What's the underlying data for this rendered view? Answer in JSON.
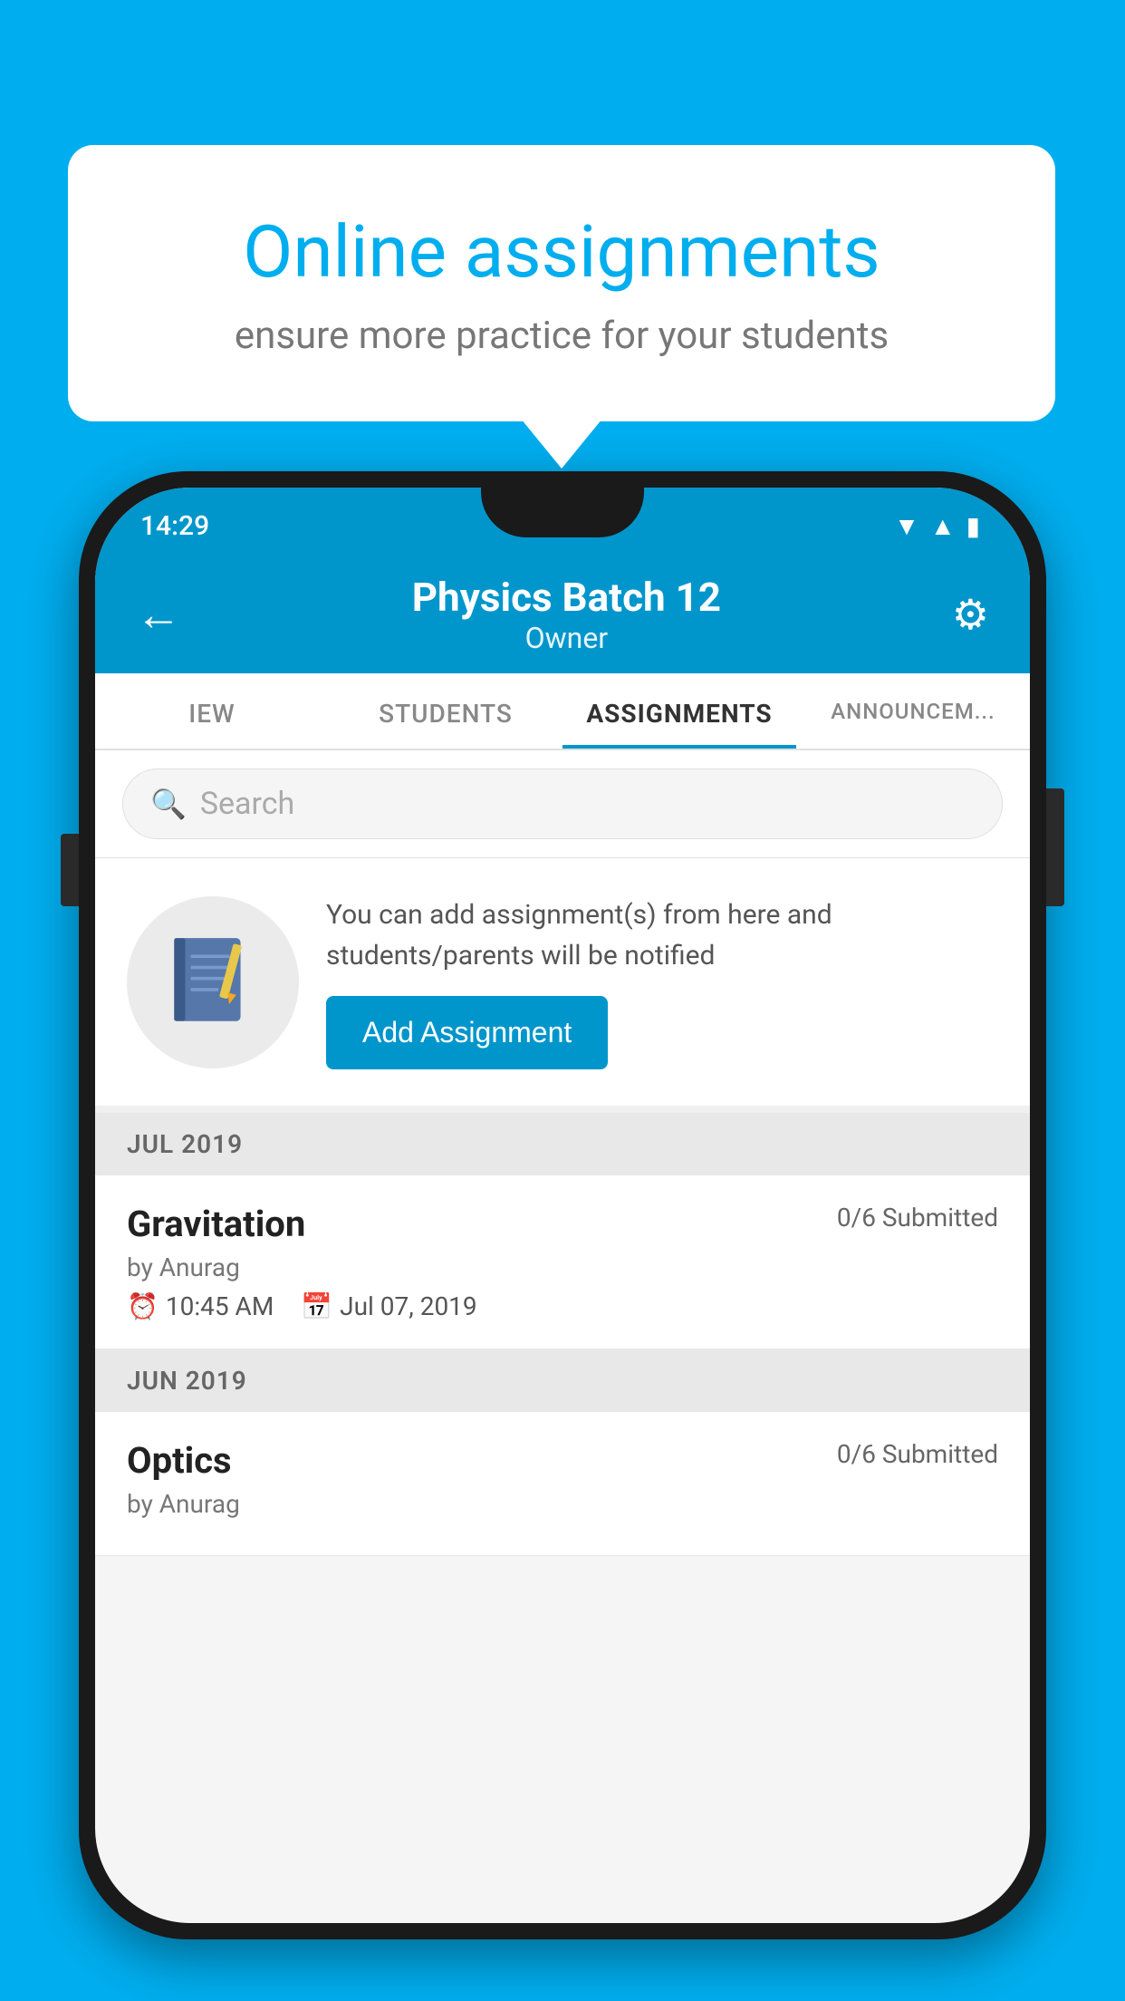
{
  "background_color": "#00AEEF",
  "bubble": {
    "title": "Online assignments",
    "subtitle": "ensure more practice for your students"
  },
  "status_bar": {
    "time": "14:29"
  },
  "header": {
    "title": "Physics Batch 12",
    "subtitle": "Owner"
  },
  "tabs": [
    {
      "label": "IEW",
      "active": false
    },
    {
      "label": "STUDENTS",
      "active": false
    },
    {
      "label": "ASSIGNMENTS",
      "active": true
    },
    {
      "label": "ANNOUNCEM...",
      "active": false
    }
  ],
  "search": {
    "placeholder": "Search"
  },
  "prompt": {
    "text": "You can add assignment(s) from here and students/parents will be notified",
    "button_label": "Add Assignment"
  },
  "sections": [
    {
      "month": "JUL 2019",
      "assignments": [
        {
          "name": "Gravitation",
          "submitted": "0/6 Submitted",
          "by": "by Anurag",
          "time": "10:45 AM",
          "date": "Jul 07, 2019"
        }
      ]
    },
    {
      "month": "JUN 2019",
      "assignments": [
        {
          "name": "Optics",
          "submitted": "0/6 Submitted",
          "by": "by Anurag",
          "time": "",
          "date": ""
        }
      ]
    }
  ]
}
